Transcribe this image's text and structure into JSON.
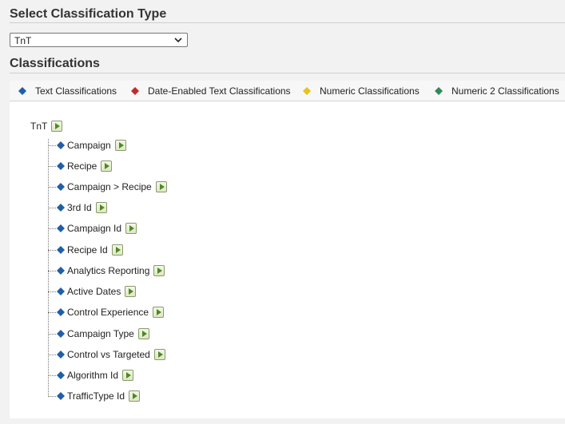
{
  "page": {
    "select_heading": "Select Classification Type",
    "classifications_heading": "Classifications"
  },
  "selector": {
    "value": "TnT"
  },
  "legend": [
    {
      "label": "Text Classifications",
      "color": "#1e5fa8"
    },
    {
      "label": "Date-Enabled Text Classifications",
      "color": "#c62828"
    },
    {
      "label": "Numeric Classifications",
      "color": "#e6c21a"
    },
    {
      "label": "Numeric 2 Classifications",
      "color": "#2e8b57"
    }
  ],
  "tree": {
    "root": "TnT",
    "children": [
      "Campaign",
      "Recipe",
      "Campaign > Recipe",
      "3rd Id",
      "Campaign Id",
      "Recipe Id",
      "Analytics Reporting",
      "Active Dates",
      "Control Experience",
      "Campaign Type",
      "Control vs Targeted",
      "Algorithm Id",
      "TrafficType Id"
    ]
  }
}
